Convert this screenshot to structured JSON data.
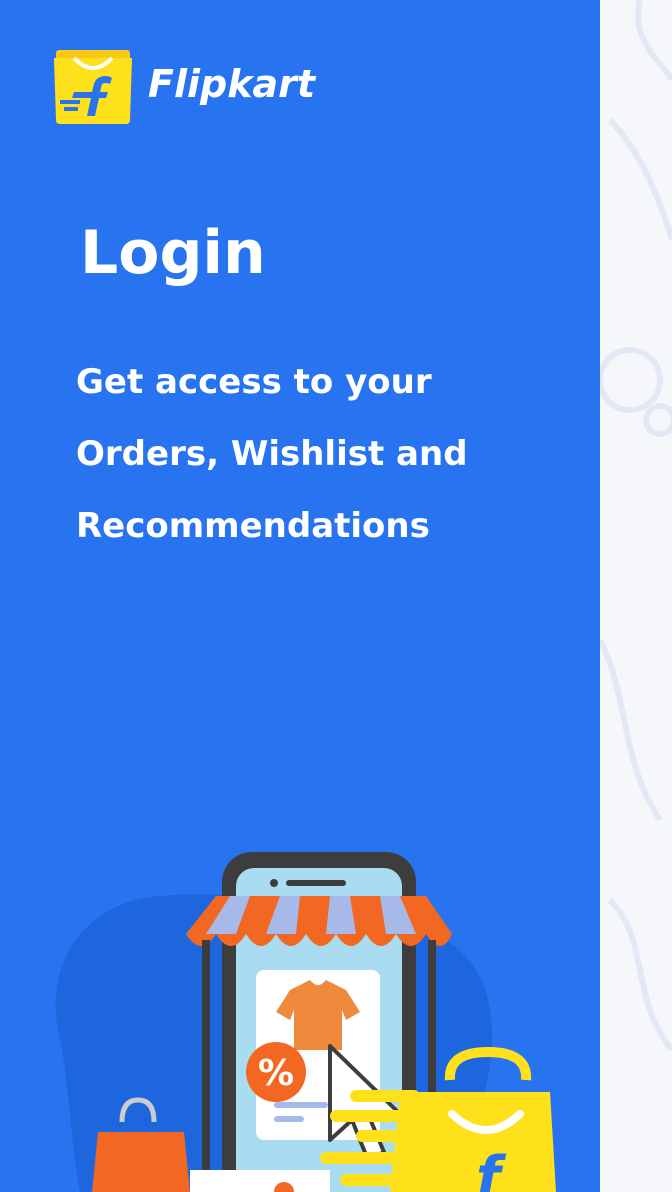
{
  "brand": {
    "name": "Flipkart",
    "colors": {
      "primary": "#2874f0",
      "yellow": "#ffe11b",
      "accent": "#f26722"
    }
  },
  "login": {
    "title": "Login",
    "subtitle": "Get access to your Orders, Wishlist and Recommendations"
  },
  "illustration": {
    "discount_symbol": "%",
    "logo_letter": "f"
  }
}
